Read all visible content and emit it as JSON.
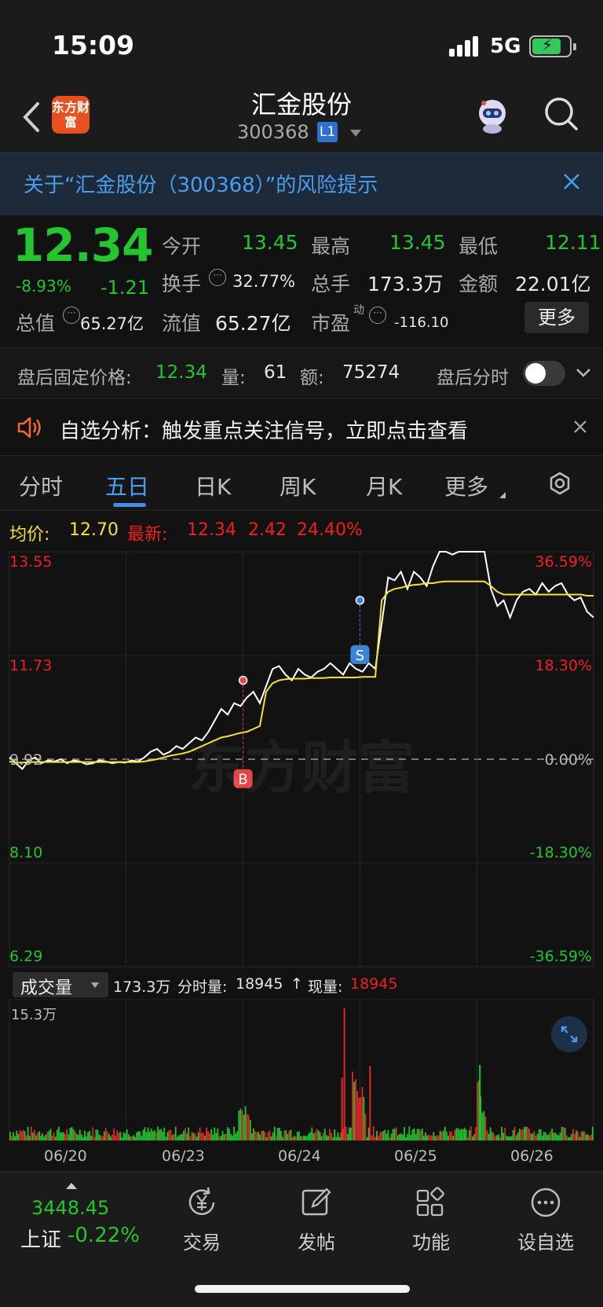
{
  "status_bar": {
    "time": "15:09",
    "network": "5G"
  },
  "header": {
    "back_icon": "chevron-left-icon",
    "logo_text": "东方财富",
    "title": "汇金股份",
    "code": "300368",
    "level_badge": "L1",
    "avatar_icon": "robot-avatar-icon",
    "search_icon": "search-icon"
  },
  "risk_banner": {
    "text": "关于“汇金股份（300368）”的风险提示"
  },
  "quote": {
    "price": "12.34",
    "change_pct": "-8.93%",
    "change": "-1.21",
    "stats": [
      {
        "label": "今开",
        "value": "13.45"
      },
      {
        "label": "最高",
        "value": "13.45"
      },
      {
        "label": "最低",
        "value": "12.11"
      },
      {
        "label": "换手",
        "value": "32.77%"
      },
      {
        "label": "总手",
        "value": "173.3万"
      },
      {
        "label": "金额",
        "value": "22.01亿"
      },
      {
        "label": "总值",
        "value": "65.27亿"
      },
      {
        "label": "流值",
        "value": "65.27亿"
      },
      {
        "label": "市盈",
        "sup": "动",
        "value": "-116.10"
      }
    ],
    "more_button": "更多"
  },
  "after_hours": {
    "label": "盘后固定价格:",
    "price": "12.34",
    "vol_label": "量:",
    "vol": "61",
    "amt_label": "额:",
    "amt": "75274",
    "toggle_label": "盘后分时"
  },
  "signal": {
    "text": "自选分析：触发重点关注信号，立即点击查看"
  },
  "tabs": [
    {
      "label": "分时",
      "active": false
    },
    {
      "label": "五日",
      "active": true
    },
    {
      "label": "日K",
      "active": false
    },
    {
      "label": "周K",
      "active": false
    },
    {
      "label": "月K",
      "active": false
    },
    {
      "label": "更多",
      "active": false
    }
  ],
  "legend": {
    "avg_label": "均价:",
    "avg": "12.70",
    "latest_label": "最新:",
    "latest": "12.34",
    "change": "2.42",
    "change_pct": "24.40%"
  },
  "chart_data": {
    "type": "line",
    "title": "",
    "y_ticks_left": [
      "13.55",
      "11.73",
      "9.92",
      "8.10",
      "6.29"
    ],
    "y_ticks_right": [
      "36.59%",
      "18.30%",
      "0.00%",
      "-18.30%",
      "-36.59%"
    ],
    "ylim": [
      6.29,
      13.55
    ],
    "base_price": 9.92,
    "x_labels": [
      "06/20",
      "06/23",
      "06/24",
      "06/25",
      "06/26"
    ],
    "series": [
      {
        "name": "price",
        "color": "#ffffff",
        "values": [
          9.95,
          9.85,
          9.75,
          9.9,
          9.95,
          9.85,
          9.9,
          9.88,
          9.92,
          9.85,
          9.9,
          9.88,
          9.83,
          9.85,
          9.9,
          9.88,
          9.85,
          9.87,
          9.86,
          9.9,
          9.88,
          9.95,
          10.05,
          10.1,
          10.0,
          10.05,
          10.15,
          10.1,
          10.2,
          10.3,
          10.25,
          10.4,
          10.6,
          10.8,
          10.7,
          10.9,
          10.85,
          11.0,
          11.1,
          10.9,
          11.2,
          11.5,
          11.55,
          11.4,
          11.3,
          11.5,
          11.4,
          11.35,
          11.45,
          11.5,
          11.6,
          11.5,
          11.4,
          11.6,
          11.5,
          11.45,
          11.6,
          11.5,
          12.3,
          13.1,
          13.05,
          13.2,
          12.9,
          13.2,
          13.1,
          12.95,
          13.3,
          13.55,
          13.55,
          13.5,
          13.55,
          13.55,
          13.55,
          13.55,
          13.55,
          12.9,
          12.6,
          12.7,
          12.4,
          12.7,
          12.85,
          12.9,
          12.8,
          13.0,
          12.85,
          12.95,
          13.0,
          12.8,
          12.7,
          12.75,
          12.5,
          12.4
        ]
      },
      {
        "name": "avg",
        "color": "#f4e03c",
        "values": [
          9.88,
          9.86,
          9.86,
          9.87,
          9.87,
          9.87,
          9.87,
          9.87,
          9.87,
          9.87,
          9.87,
          9.87,
          9.87,
          9.87,
          9.87,
          9.87,
          9.87,
          9.87,
          9.87,
          9.87,
          9.87,
          9.88,
          9.9,
          9.92,
          9.95,
          9.98,
          10.0,
          10.02,
          10.05,
          10.1,
          10.15,
          10.2,
          10.25,
          10.3,
          10.32,
          10.35,
          10.38,
          10.4,
          10.45,
          10.5,
          11.1,
          11.25,
          11.3,
          11.32,
          11.33,
          11.33,
          11.33,
          11.34,
          11.34,
          11.34,
          11.35,
          11.35,
          11.35,
          11.35,
          11.35,
          11.36,
          11.36,
          11.36,
          12.7,
          12.85,
          12.9,
          12.92,
          12.95,
          12.97,
          12.98,
          13.0,
          13.0,
          13.02,
          13.03,
          13.03,
          13.03,
          13.03,
          13.03,
          13.03,
          13.03,
          12.95,
          12.85,
          12.8,
          12.8,
          12.8,
          12.8,
          12.8,
          12.8,
          12.8,
          12.8,
          12.8,
          12.8,
          12.8,
          12.8,
          12.8,
          12.78,
          12.78
        ]
      }
    ],
    "markers": [
      {
        "label": "B",
        "date": "06/23"
      },
      {
        "label": "S",
        "date": "06/24"
      }
    ]
  },
  "volume": {
    "selector": "成交量",
    "total": "173.3万",
    "minute_label": "分时量:",
    "minute": "18945",
    "arrow": "↑",
    "now_label": "现量:",
    "now": "18945",
    "max_label": "15.3万",
    "expand_icon": "expand-icon"
  },
  "bottom_nav": {
    "index_value": "3448.45",
    "index_name": "上证",
    "index_change": "-0.22%",
    "items": [
      {
        "label": "交易",
        "icon": "yen-exchange-icon"
      },
      {
        "label": "发帖",
        "icon": "edit-post-icon"
      },
      {
        "label": "功能",
        "icon": "grid-apps-icon"
      },
      {
        "label": "设自选",
        "icon": "more-dots-icon"
      }
    ]
  }
}
